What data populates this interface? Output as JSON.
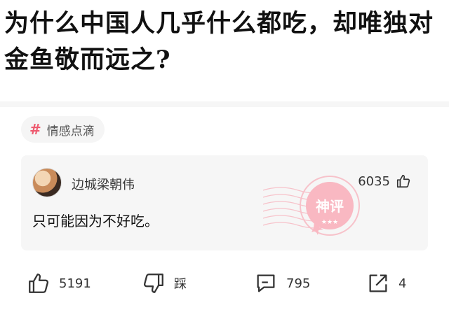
{
  "question": {
    "title": "为什么中国人几乎什么都吃，却唯独对金鱼敬而远之?"
  },
  "tag": {
    "icon": "hash-icon",
    "label": "情感点滴"
  },
  "top_comment": {
    "username": "边城梁朝伟",
    "likes": "6035",
    "text": "只可能因为不好吃。",
    "stamp_label": "神评"
  },
  "actions": {
    "upvote_count": "5191",
    "downvote_label": "踩",
    "comment_count": "795",
    "share_count": "4"
  },
  "colors": {
    "accent": "#ee5a6f",
    "stamp": "#f7a9b4",
    "card_bg": "#f6f6f6"
  }
}
